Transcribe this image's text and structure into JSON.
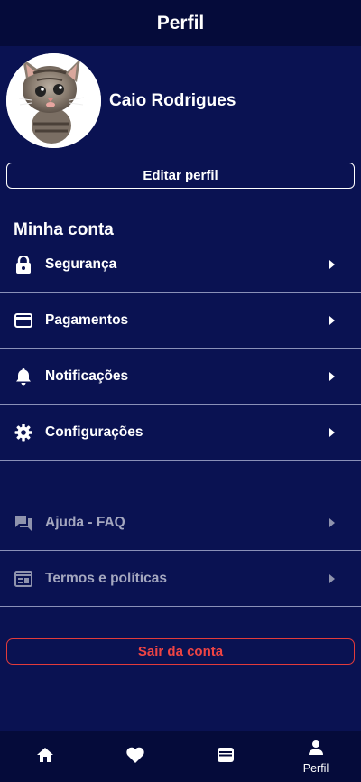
{
  "header": {
    "title": "Perfil"
  },
  "profile": {
    "name": "Caio Rodrigues",
    "avatar_icon": "kitten-photo"
  },
  "edit_button_label": "Editar perfil",
  "account_section": {
    "title": "Minha conta",
    "items": [
      {
        "label": "Segurança",
        "icon": "lock-icon"
      },
      {
        "label": "Pagamentos",
        "icon": "credit-card-icon"
      },
      {
        "label": "Notificações",
        "icon": "bell-icon"
      },
      {
        "label": "Configurações",
        "icon": "gear-icon"
      }
    ]
  },
  "help_section": {
    "items": [
      {
        "label": "Ajuda - FAQ",
        "icon": "chat-icon"
      },
      {
        "label": "Termos e políticas",
        "icon": "document-icon"
      }
    ]
  },
  "logout_label": "Sair da conta",
  "bottom_nav": {
    "items": [
      {
        "icon": "home-icon",
        "label": ""
      },
      {
        "icon": "heart-icon",
        "label": ""
      },
      {
        "icon": "wallet-icon",
        "label": ""
      },
      {
        "icon": "person-icon",
        "label": "Perfil",
        "active": true
      }
    ]
  },
  "colors": {
    "background": "#0a1252",
    "header": "#050b3a",
    "text": "#ffffff",
    "muted_text": "#a4a7bf",
    "danger": "#ef4444"
  }
}
